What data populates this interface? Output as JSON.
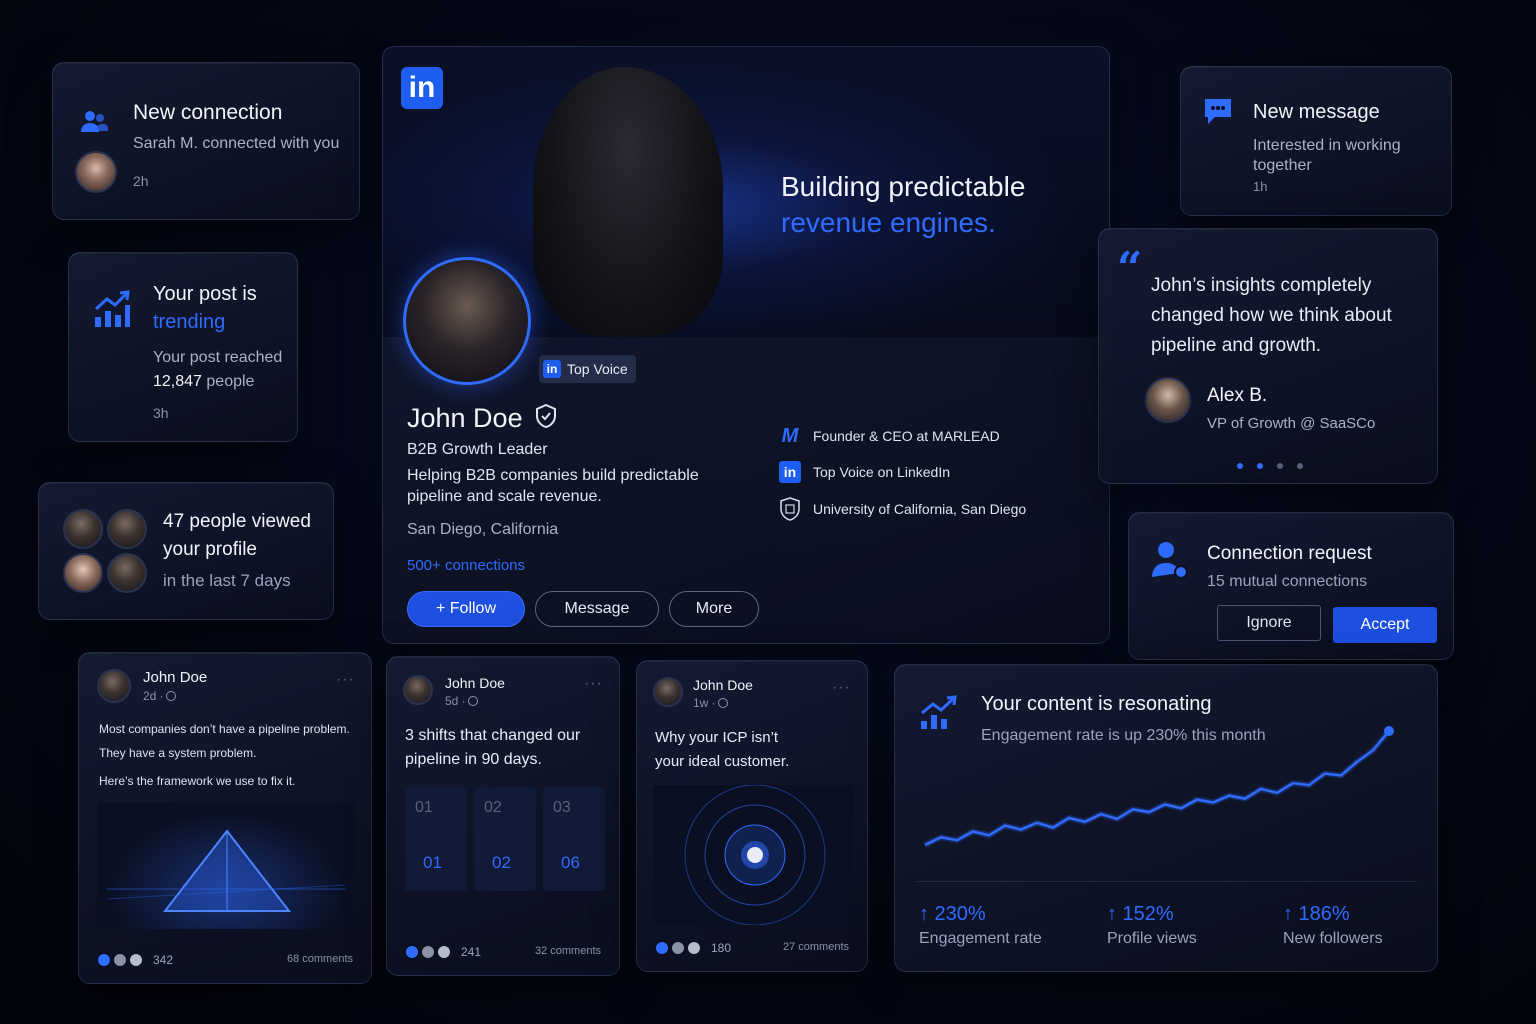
{
  "new_connection": {
    "title": "New connection",
    "subtitle": "Sarah M. connected with you",
    "time": "2h"
  },
  "trending": {
    "title_line1": "Your post is",
    "title_line2": "trending",
    "sub_line1": "Your post reached",
    "sub_line2_number": "12,847",
    "sub_line2_rest": "people",
    "time": "3h"
  },
  "profile_views": {
    "line1": "47 people viewed",
    "line2": "your profile",
    "line3": "in the last 7 days"
  },
  "profile": {
    "logo": "in",
    "tagline_line1": "Building predictable",
    "tagline_line2": "revenue engines.",
    "badge_logo": "in",
    "badge": "Top Voice",
    "name": "John Doe",
    "headline": "B2B Growth Leader",
    "about_line1": "Helping B2B companies build predictable",
    "about_line2": "pipeline and scale revenue.",
    "location": "San Diego, California",
    "connections": "500+ connections",
    "follow_label": "+ Follow",
    "message_label": "Message",
    "more_label": "More",
    "details": [
      {
        "icon": "marlead-logo-icon",
        "glyph": "M",
        "text": "Founder & CEO at MARLEAD"
      },
      {
        "icon": "linkedin-icon",
        "glyph": "in",
        "text": "Top Voice on LinkedIn"
      },
      {
        "icon": "university-shield-icon",
        "glyph": "",
        "text": "University of California, San Diego"
      }
    ]
  },
  "new_message": {
    "title": "New message",
    "line1": "Interested in working",
    "line2": "together",
    "time": "1h"
  },
  "testimonial": {
    "quote_mark": "“",
    "line1": "John’s insights completely",
    "line2": "changed how we think about",
    "line3": "pipeline and growth.",
    "author": "Alex B.",
    "author_title": "VP of Growth @ SaaSCo"
  },
  "connection_request": {
    "title": "Connection request",
    "subtitle": "15 mutual connections",
    "ignore_label": "Ignore",
    "accept_label": "Accept"
  },
  "posts": [
    {
      "author": "John Doe",
      "meta": "2d · ",
      "line1": "Most companies don’t have a pipeline problem.",
      "line2": "They have a system problem.",
      "line3": "Here’s the framework we use to fix it.",
      "reactions": "342",
      "comments": "68 comments"
    },
    {
      "author": "John Doe",
      "meta": "5d · ",
      "line1": "3 shifts that changed our",
      "line2": "pipeline in 90 days.",
      "steps": [
        "01",
        "02",
        "03"
      ],
      "step_big": [
        "01",
        "02",
        "06"
      ],
      "reactions": "241",
      "comments": "32 comments"
    },
    {
      "author": "John Doe",
      "meta": "1w · ",
      "line1": "Why your ICP isn’t",
      "line2": "your ideal customer.",
      "reactions": "180",
      "comments": "27 comments"
    }
  ],
  "resonating": {
    "title": "Your content is resonating",
    "subtitle": "Engagement rate is up 230% this month",
    "stats": [
      {
        "value": "↑ 230%",
        "label": "Engagement rate"
      },
      {
        "value": "↑ 152%",
        "label": "Profile views"
      },
      {
        "value": "↑ 186%",
        "label": "New followers"
      }
    ]
  },
  "chart_data": {
    "type": "line",
    "trend": [
      10,
      18,
      15,
      24,
      20,
      30,
      26,
      33,
      28,
      38,
      34,
      42,
      37,
      47,
      44,
      52,
      48,
      57,
      54,
      61,
      58,
      68,
      64,
      74,
      72,
      84,
      82,
      96,
      108,
      128
    ],
    "color": "#2f6bff"
  },
  "colors": {
    "accent": "#2f6bff",
    "primary_button": "#1d4fe0"
  }
}
